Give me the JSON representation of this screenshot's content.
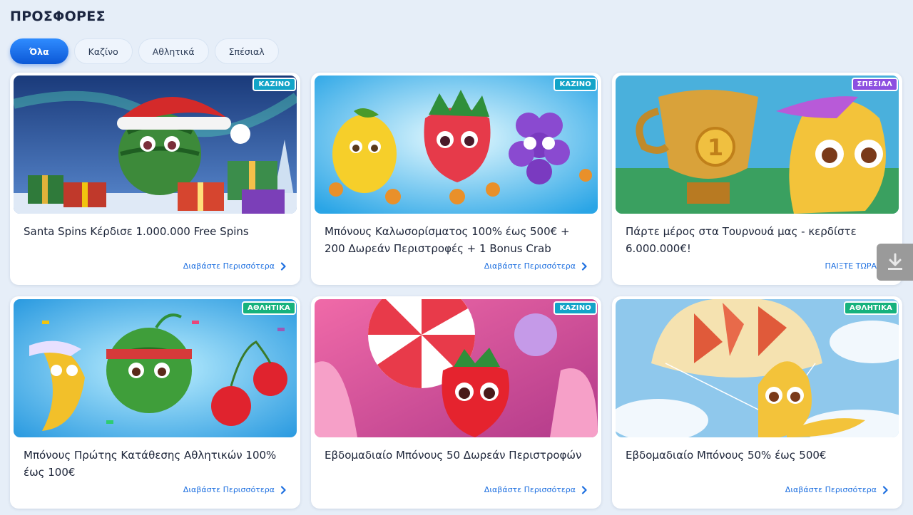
{
  "page": {
    "title": "ΠΡΟΣΦΟΡΕΣ"
  },
  "filters": [
    {
      "label": "Όλα",
      "active": true
    },
    {
      "label": "Καζίνο",
      "active": false
    },
    {
      "label": "Αθλητικά",
      "active": false
    },
    {
      "label": "Σπέσιαλ",
      "active": false
    }
  ],
  "promotions": [
    {
      "badge": "ΚΑΖΙΝΟ",
      "title": "Santa Spins Κέρδισε 1.000.000 Free Spins",
      "cta": "Διαβάστε Περισσότερα"
    },
    {
      "badge": "ΚΑΖΙΝΟ",
      "title": "Μπόνους Καλωσορίσματος 100% έως 500€ + 200 Δωρεάν Περιστροφές + 1 Bonus Crab",
      "cta": "Διαβάστε Περισσότερα"
    },
    {
      "badge": "ΣΠΕΣΙΑΛ",
      "title": "Πάρτε μέρος στα Τουρνουά μας - κερδίστε 6.000.000€!",
      "cta": "ΠΑΙΞΤΕ ΤΩΡΑ"
    },
    {
      "badge": "ΑΘΛΗΤΙΚΑ",
      "title": "Μπόνους Πρώτης Κατάθεσης Αθλητικών 100% έως 100€",
      "cta": "Διαβάστε Περισσότερα"
    },
    {
      "badge": "ΚΑΖΙΝΟ",
      "title": "Εβδομαδιαίο Μπόνους 50 Δωρεάν Περιστροφών",
      "cta": "Διαβάστε Περισσότερα"
    },
    {
      "badge": "ΑΘΛΗΤΙΚΑ",
      "title": "Εβδομαδιαίο Μπόνους 50% έως 500€",
      "cta": "Διαβάστε Περισσότερα"
    }
  ],
  "colors": {
    "accent": "#1d6fe0",
    "casino_badge": "#12a4c8",
    "special_badge": "#8c4fe0",
    "sports_badge": "#16b27d"
  },
  "icons": {
    "cta": "chevron-right-icon",
    "download": "download-icon"
  }
}
